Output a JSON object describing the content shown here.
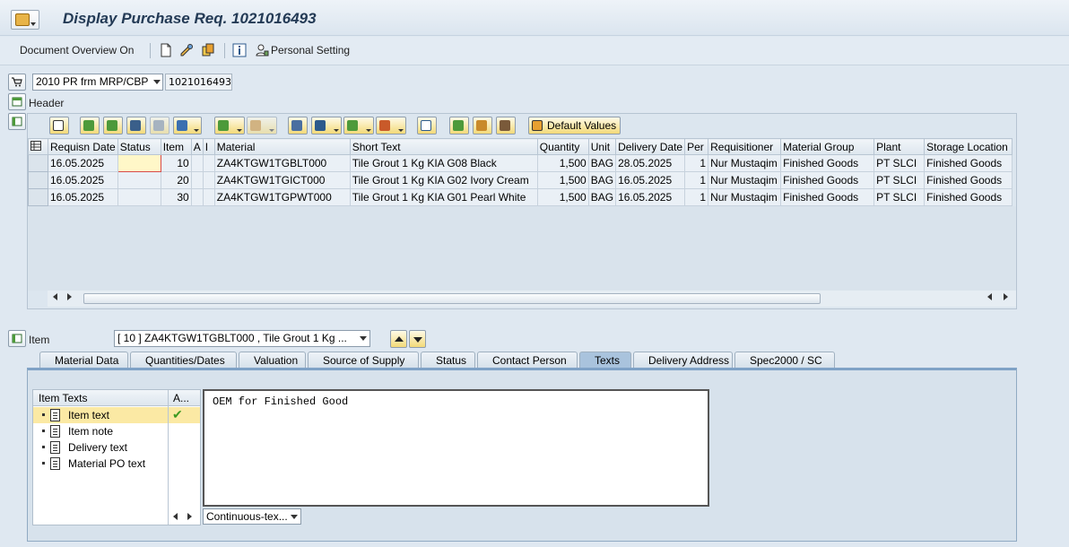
{
  "window": {
    "title": "Display Purchase Req. 1021016493"
  },
  "toolbar": {
    "document_overview": "Document Overview On",
    "personal_setting": "Personal Setting"
  },
  "document": {
    "type_value": "2010 PR frm MRP/CBP",
    "number": "1021016493",
    "header_label": "Header"
  },
  "grid": {
    "default_values_button": "Default Values",
    "columns": [
      "Requisn Date",
      "Status",
      "Item",
      "A",
      "I",
      "Material",
      "Short Text",
      "Quantity",
      "Unit",
      "Delivery Date",
      "Per",
      "Requisitioner",
      "Material Group",
      "Plant",
      "Storage Location"
    ],
    "rows": [
      [
        "16.05.2025",
        "",
        "10",
        "",
        "",
        "ZA4KTGW1TGBLT000",
        "Tile Grout 1 Kg KIA G08 Black",
        "1,500",
        "BAG",
        "28.05.2025",
        "1",
        "Nur Mustaqim",
        "Finished Goods",
        "PT SLCI",
        "Finished Goods"
      ],
      [
        "16.05.2025",
        "",
        "20",
        "",
        "",
        "ZA4KTGW1TGICT000",
        "Tile Grout 1 Kg KIA G02 Ivory Cream",
        "1,500",
        "BAG",
        "16.05.2025",
        "1",
        "Nur Mustaqim",
        "Finished Goods",
        "PT SLCI",
        "Finished Goods"
      ],
      [
        "16.05.2025",
        "",
        "30",
        "",
        "",
        "ZA4KTGW1TGPWT000",
        "Tile Grout 1 Kg KIA G01 Pearl White",
        "1,500",
        "BAG",
        "16.05.2025",
        "1",
        "Nur Mustaqim",
        "Finished Goods",
        "PT SLCI",
        "Finished Goods"
      ]
    ]
  },
  "item": {
    "label": "Item",
    "selected": "[ 10 ] ZA4KTGW1TGBLT000 , Tile Grout 1 Kg ..."
  },
  "tabs": [
    "Material Data",
    "Quantities/Dates",
    "Valuation",
    "Source of Supply",
    "Status",
    "Contact Person",
    "Texts",
    "Delivery Address",
    "Spec2000 / SC"
  ],
  "active_tab": "Texts",
  "texts": {
    "tree_header": "Item Texts",
    "tree_header_col2": "A...",
    "items": [
      "Item text",
      "Item note",
      "Delivery text",
      "Material PO text"
    ],
    "active_check": "✔",
    "content": "OEM for Finished Good",
    "format_select": "Continuous-tex..."
  },
  "colors": {
    "accent": "#f3d978",
    "title": "#233a55",
    "active_tab": "#a9c3dd"
  }
}
